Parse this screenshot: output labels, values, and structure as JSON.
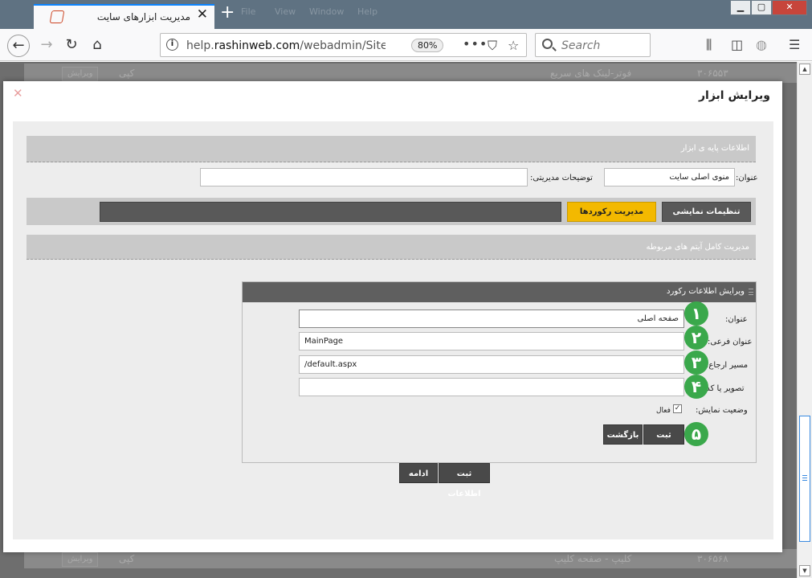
{
  "browser": {
    "tab_title": "مدیریت ابزارهای سایت",
    "menu_ghost": [
      "File",
      "View",
      "Window",
      "Help"
    ],
    "url_prefix": "help.",
    "url_domain": "rashinweb.com",
    "url_path": "/webadmin/Site_gad",
    "zoom": "80%",
    "search_placeholder": "Search"
  },
  "background_page": {
    "row1": {
      "id": "۳۰۶۵۵۳",
      "title": "فوتر-لینک های سریع",
      "copy": "کپی",
      "edit": "ویرایش"
    },
    "row2": {
      "id": "۳۰۶۵۶۸",
      "title": "کلیپ - صفحه کلیپ",
      "copy": "کپی",
      "edit": "ویرایش"
    }
  },
  "modal": {
    "title": "ویرایش ابزار",
    "base_info": {
      "header": "اطلاعات پایه ی ابزار",
      "title_label": "عنوان:",
      "title_value": "منوی اصلی سایت",
      "admin_desc_label": "توضیحات مدیریتی:",
      "admin_desc_value": ""
    },
    "tabs": {
      "display_settings": "تنظیمات نمایشی",
      "records": "مدیریت رکوردها"
    },
    "items_section": {
      "header": "مدیریت کامل آیتم های مربوطه"
    },
    "record_panel": {
      "header": "ویرایش اطلاعات رکورد",
      "fields": [
        {
          "label": "عنوان:",
          "value": "صفحه اصلی",
          "badge": "۱"
        },
        {
          "label": "عنوان فرعی:",
          "value": "MainPage",
          "badge": "۲"
        },
        {
          "label": "مسیر ارجاع:",
          "value": "/default.aspx",
          "badge": "۳"
        },
        {
          "label": "تصویر یا کد:",
          "value": "",
          "badge": "۴"
        }
      ],
      "status_label": "وضعیت نمایش:",
      "status_checkbox_label": "فعال",
      "status_checked": true,
      "submit": "ثبت",
      "back": "بازگشت",
      "submit_badge": "۵"
    },
    "footer": {
      "save": "ثبت اطلاعات",
      "continue": "ادامه"
    }
  }
}
